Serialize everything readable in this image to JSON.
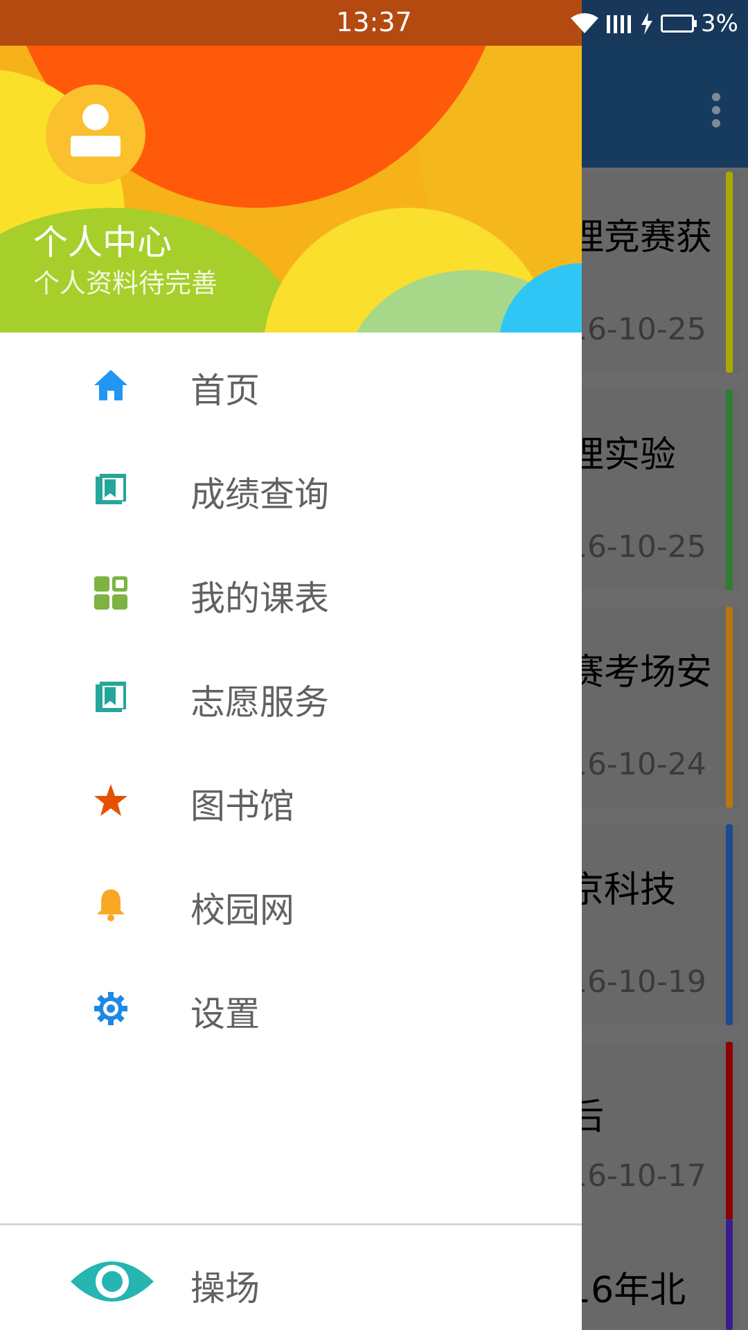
{
  "status_bar": {
    "time": "13:37",
    "battery": "3%"
  },
  "drawer": {
    "profile": {
      "name": "个人中心",
      "subtitle": "个人资料待完善"
    },
    "menu": [
      {
        "label": "首页",
        "icon": "home-icon",
        "color": "#2196f3"
      },
      {
        "label": "成绩查询",
        "icon": "book-icon",
        "color": "#26a69a"
      },
      {
        "label": "我的课表",
        "icon": "grid-icon",
        "color": "#7cb342"
      },
      {
        "label": "志愿服务",
        "icon": "book-icon",
        "color": "#26a69a"
      },
      {
        "label": "图书馆",
        "icon": "star-icon",
        "color": "#e65100"
      },
      {
        "label": "校园网",
        "icon": "bell-icon",
        "color": "#f9a825"
      },
      {
        "label": "设置",
        "icon": "gear-icon",
        "color": "#1e88e5"
      }
    ],
    "bottom_item": {
      "label": "操场",
      "icon": "eye-icon",
      "color": "#26b5b0"
    }
  },
  "background_list": [
    {
      "title": "理竞赛获",
      "date": "16-10-25",
      "stripe_color": "#a8a800"
    },
    {
      "title": "理实验",
      "date": "16-10-25",
      "stripe_color": "#2e7d32"
    },
    {
      "title": "赛考场安",
      "date": "16-10-24",
      "stripe_color": "#b9770e"
    },
    {
      "title": "京科技",
      "date": "16-10-19",
      "stripe_color": "#1e4b8f"
    },
    {
      "title": "后",
      "date": "16-10-17",
      "stripe_color": "#8b0000"
    },
    {
      "title": "16年北",
      "date": "",
      "stripe_color": "#3b1c8c"
    }
  ]
}
